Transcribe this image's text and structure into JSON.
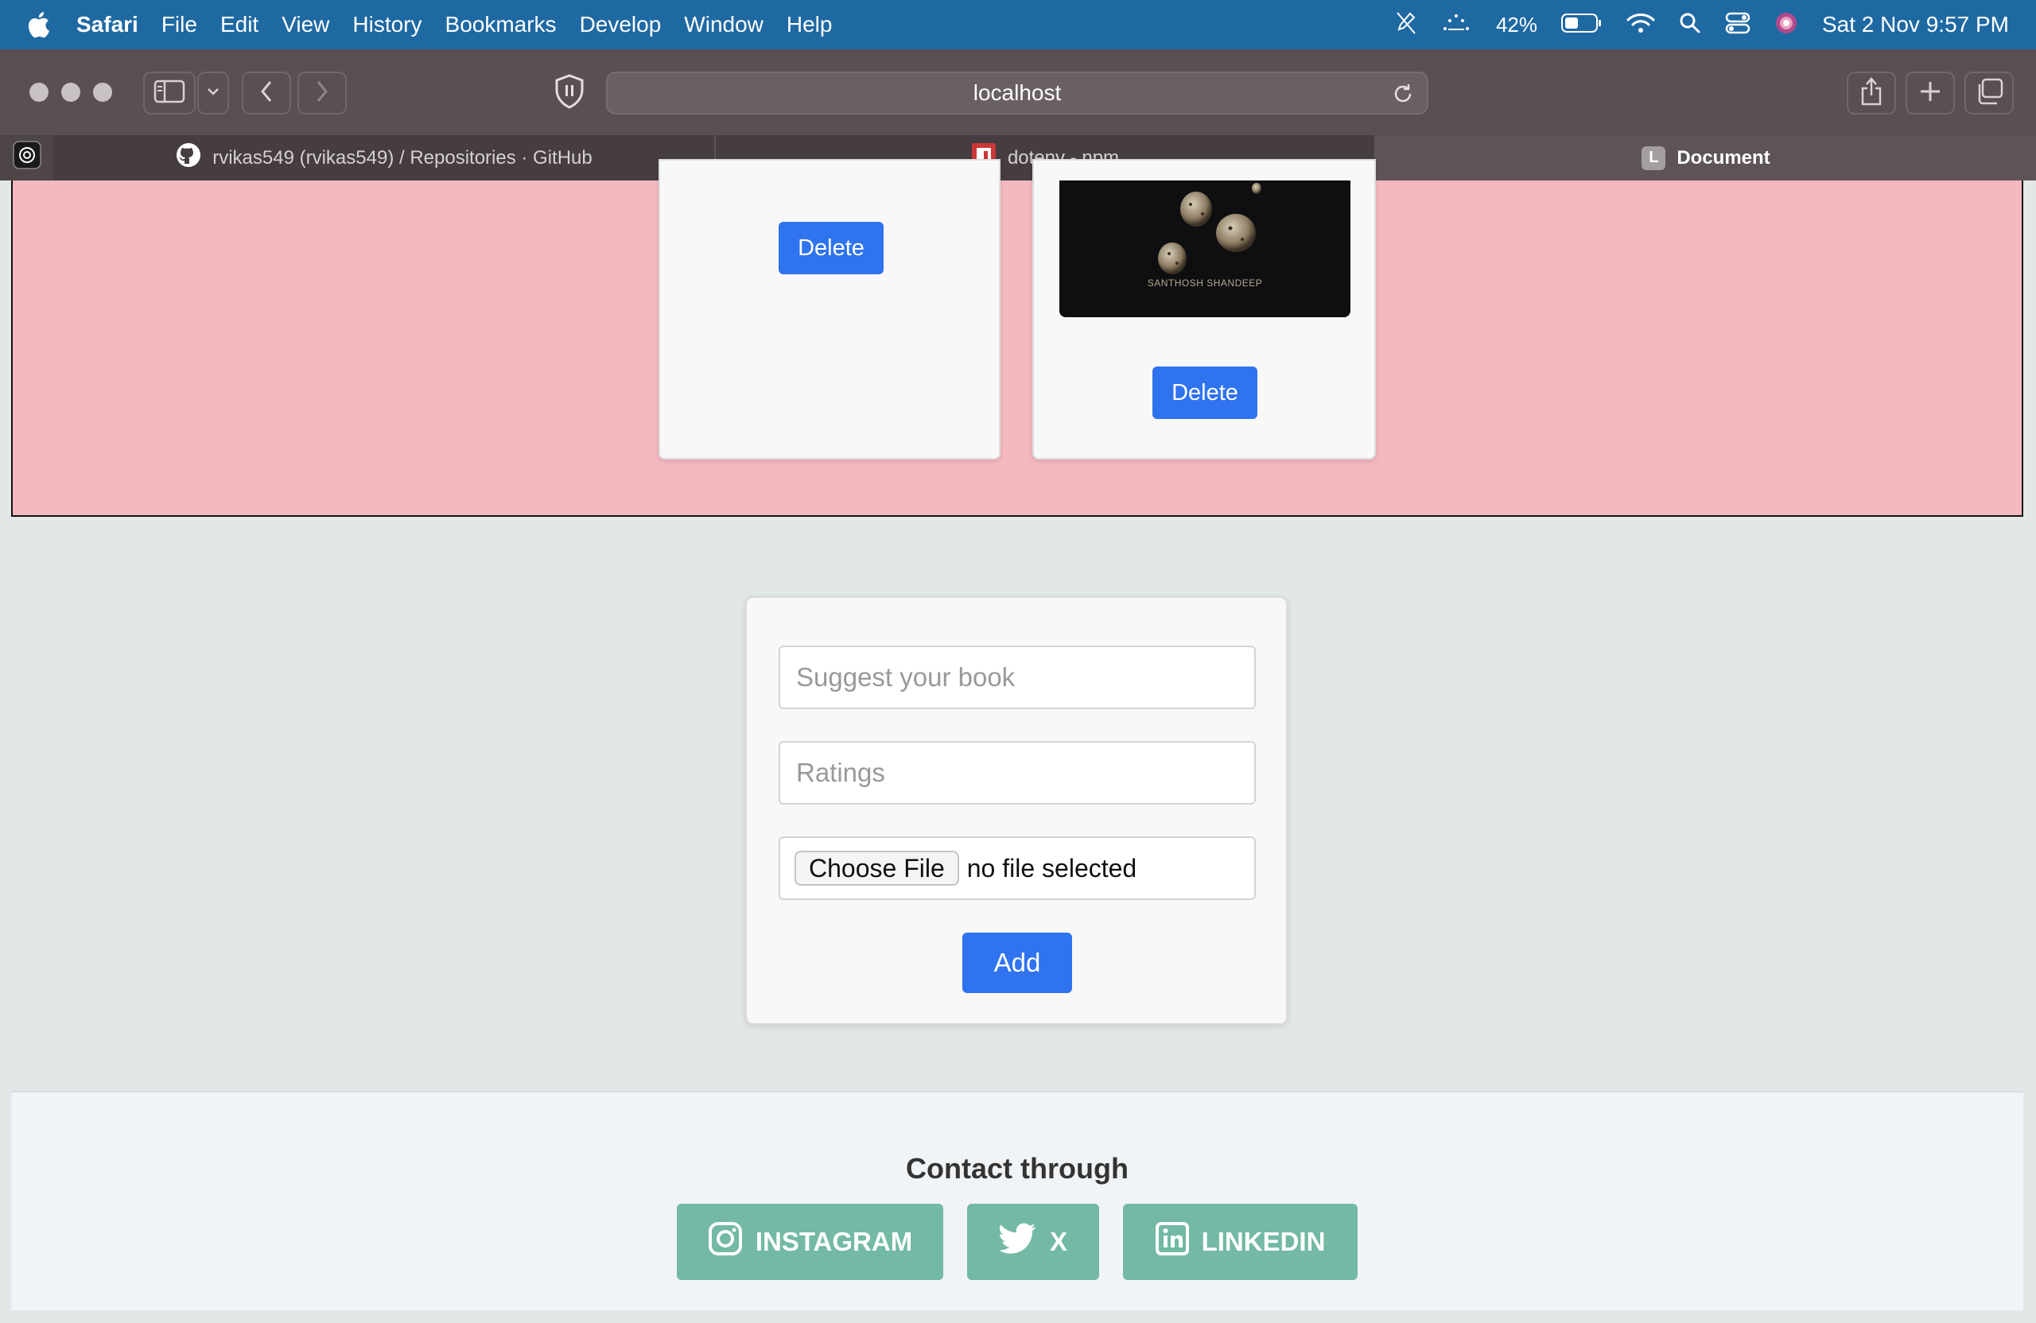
{
  "menubar": {
    "app": "Safari",
    "items": [
      "File",
      "Edit",
      "View",
      "History",
      "Bookmarks",
      "Develop",
      "Window",
      "Help"
    ],
    "battery": "42%",
    "clock": "Sat 2 Nov  9:57 PM"
  },
  "browser": {
    "url": "localhost",
    "tabs": [
      {
        "title": "rvikas549 (rvikas549) / Repositories · GitHub"
      },
      {
        "title": "dotenv - npm"
      },
      {
        "title": "Document",
        "icon_letter": "L"
      }
    ]
  },
  "page": {
    "cards": [
      {
        "delete_label": "Delete"
      },
      {
        "delete_label": "Delete",
        "cover_caption": "SANTHOSH SHANDEEP"
      }
    ],
    "form": {
      "book_placeholder": "Suggest your book",
      "ratings_placeholder": "Ratings",
      "file_button": "Choose File",
      "file_status": "no file selected",
      "submit_label": "Add"
    },
    "footer": {
      "title": "Contact through",
      "links": [
        "INSTAGRAM",
        "X",
        "LINKEDIN"
      ]
    }
  },
  "colors": {
    "menubar": "#1f69a3",
    "pink_section": "#f4b8bf",
    "primary_button": "#2f73ee",
    "social_button": "#73b9a5",
    "page_bg": "#e2e7e7"
  }
}
